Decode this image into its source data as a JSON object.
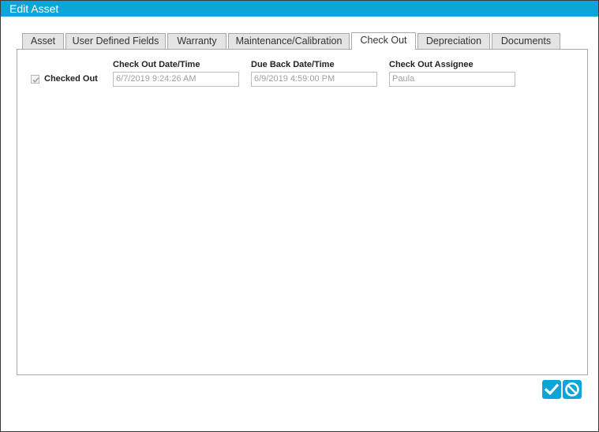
{
  "window": {
    "title": "Edit Asset"
  },
  "tabs": [
    {
      "label": "Asset",
      "active": false
    },
    {
      "label": "User Defined Fields",
      "active": false
    },
    {
      "label": "Warranty",
      "active": false
    },
    {
      "label": "Maintenance/Calibration",
      "active": false
    },
    {
      "label": "Check Out",
      "active": true
    },
    {
      "label": "Depreciation",
      "active": false
    },
    {
      "label": "Documents",
      "active": false
    }
  ],
  "checkout": {
    "checked_out_label": "Checked Out",
    "checked_out": true,
    "fields": [
      {
        "label": "Check Out Date/Time",
        "value": "6/7/2019 9:24:26 AM"
      },
      {
        "label": "Due Back Date/Time",
        "value": "6/9/2019 4:59:00 PM"
      },
      {
        "label": "Check Out Assignee",
        "value": "Paula"
      }
    ]
  },
  "actions": {
    "save_icon": "check-icon",
    "cancel_icon": "cancel-icon"
  },
  "colors": {
    "accent": "#0da4d8"
  }
}
